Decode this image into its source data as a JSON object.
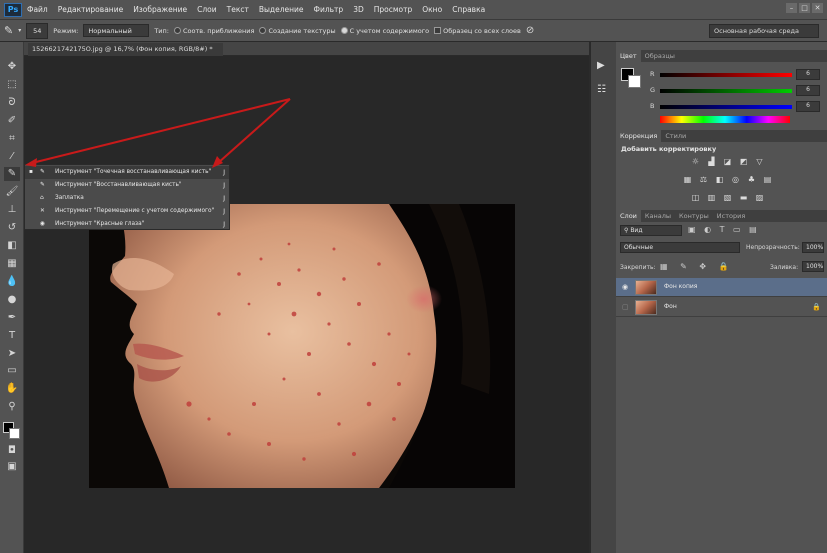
{
  "app": {
    "logo": "Ps"
  },
  "menu": [
    "Файл",
    "Редактирование",
    "Изображение",
    "Слои",
    "Текст",
    "Выделение",
    "Фильтр",
    "3D",
    "Просмотр",
    "Окно",
    "Справка"
  ],
  "options": {
    "brush_size": "54",
    "mode_label": "Режим:",
    "mode_value": "Нормальный",
    "type_label": "Тип:",
    "radio1": "Соотв. приближения",
    "radio2": "Создание текстуры",
    "radio3": "С учетом содержимого",
    "check": "Образец со всех слоев",
    "workspace": "Основная рабочая среда"
  },
  "document": {
    "tab_title": "1526621742175O.jpg @ 16,7% (Фон копия, RGB/8#) *"
  },
  "flyout": {
    "items": [
      {
        "label": "Инструмент \"Точечная восстанавливающая кисть\"",
        "shortcut": "J"
      },
      {
        "label": "Инструмент \"Восстанавливающая кисть\"",
        "shortcut": "J"
      },
      {
        "label": "Заплатка",
        "shortcut": "J"
      },
      {
        "label": "Инструмент \"Перемещение с учетом содержимого\"",
        "shortcut": "J"
      },
      {
        "label": "Инструмент \"Красные глаза\"",
        "shortcut": "J"
      }
    ]
  },
  "color_panel": {
    "tabs": [
      "Цвет",
      "Образцы"
    ],
    "channels": [
      {
        "label": "R",
        "value": "6"
      },
      {
        "label": "G",
        "value": "6"
      },
      {
        "label": "B",
        "value": "6"
      }
    ]
  },
  "adjustments_panel": {
    "tabs": [
      "Коррекция",
      "Стили"
    ],
    "title": "Добавить корректировку"
  },
  "layers_panel": {
    "tabs": [
      "Слои",
      "Каналы",
      "Контуры",
      "История"
    ],
    "kind": "Вид",
    "blend": "Обычные",
    "opacity_label": "Непрозрачность:",
    "opacity_value": "100%",
    "lock_label": "Закрепить:",
    "fill_label": "Заливка:",
    "fill_value": "100%",
    "layers": [
      {
        "name": "Фон копия",
        "selected": true
      },
      {
        "name": "Фон",
        "selected": false
      }
    ]
  },
  "colors": {
    "accent_arrow": "#c81a1a",
    "selected_layer": "#5b6e8a"
  }
}
